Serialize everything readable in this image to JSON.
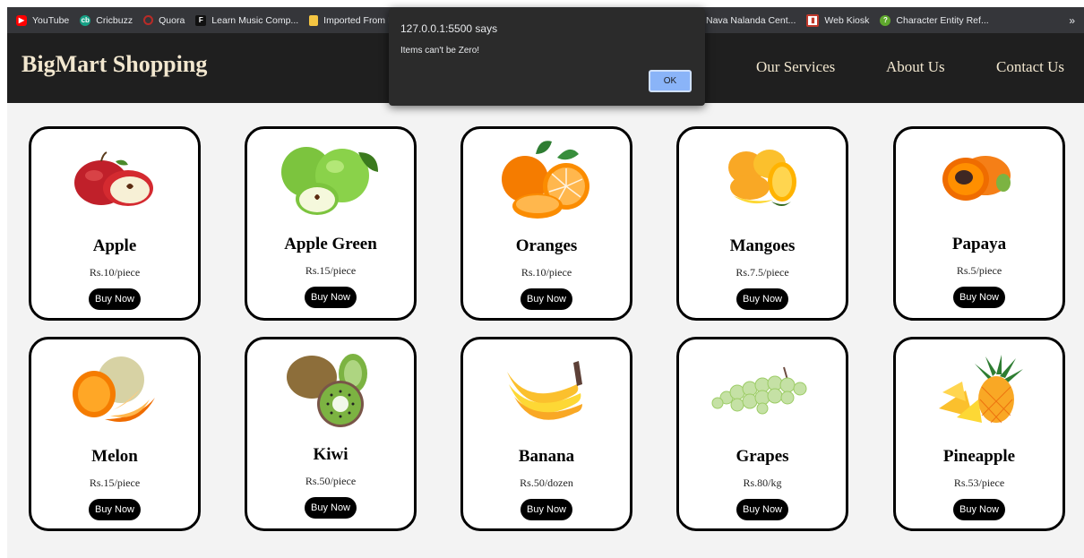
{
  "bookmarks": [
    {
      "label": "YouTube",
      "icon": "youtube-icon",
      "color": "#ff0000"
    },
    {
      "label": "Cricbuzz",
      "icon": "cricbuzz-icon",
      "color": "#16a085"
    },
    {
      "label": "Quora",
      "icon": "quora-icon",
      "color": "#b92b27"
    },
    {
      "label": "Learn Music Comp...",
      "icon": "music-icon",
      "color": "#444444"
    },
    {
      "label": "Imported From IE",
      "icon": "folder-icon",
      "color": "#f4c542"
    }
  ],
  "bookmarks_right": [
    {
      "label": "Nava Nalanda Cent...",
      "icon": "blank-icon",
      "color": "#35363a"
    },
    {
      "label": "Web Kiosk",
      "icon": "webkiosk-icon",
      "color": "#c0392b"
    },
    {
      "label": "Character Entity Ref...",
      "icon": "question-icon",
      "color": "#5fa82d"
    }
  ],
  "bookmarks_more": "»",
  "nav": {
    "brand": "BigMart Shopping",
    "links": [
      "Our Services",
      "About Us",
      "Contact Us"
    ]
  },
  "dialog": {
    "origin": "127.0.0.1:5500 says",
    "message": "Items can't be Zero!",
    "ok_label": "OK"
  },
  "products": [
    {
      "name": "Apple",
      "price": "Rs.10/piece",
      "icon": "red-apple-icon"
    },
    {
      "name": "Apple Green",
      "price": "Rs.15/piece",
      "icon": "green-apple-icon"
    },
    {
      "name": "Oranges",
      "price": "Rs.10/piece",
      "icon": "orange-icon"
    },
    {
      "name": "Mangoes",
      "price": "Rs.7.5/piece",
      "icon": "mango-icon"
    },
    {
      "name": "Papaya",
      "price": "Rs.5/piece",
      "icon": "papaya-icon"
    },
    {
      "name": "Melon",
      "price": "Rs.15/piece",
      "icon": "melon-icon"
    },
    {
      "name": "Kiwi",
      "price": "Rs.50/piece",
      "icon": "kiwi-icon"
    },
    {
      "name": "Banana",
      "price": "Rs.50/dozen",
      "icon": "banana-icon"
    },
    {
      "name": "Grapes",
      "price": "Rs.80/kg",
      "icon": "grapes-icon"
    },
    {
      "name": "Pineapple",
      "price": "Rs.53/piece",
      "icon": "pineapple-icon"
    }
  ],
  "buy_label": "Buy Now"
}
